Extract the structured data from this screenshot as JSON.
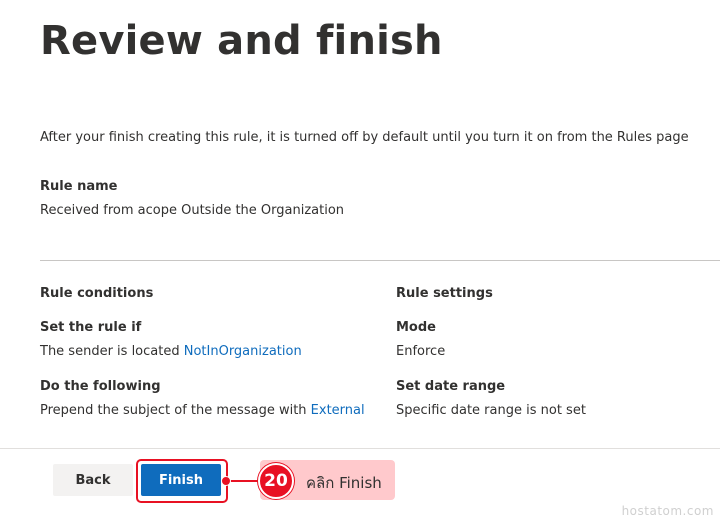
{
  "page": {
    "title": "Review and finish",
    "intro": "After your finish creating this rule, it is turned off by default until you turn it on from the Rules page"
  },
  "rule_name": {
    "label": "Rule name",
    "value": "Received from acope Outside the Organization"
  },
  "rule_conditions": {
    "heading": "Rule conditions",
    "set_rule_if": {
      "label": "Set the rule if",
      "text": "The sender is located ",
      "link": "NotInOrganization"
    },
    "do_following": {
      "label": "Do the following",
      "text": "Prepend the subject of the message with ",
      "link": "External"
    }
  },
  "rule_settings": {
    "heading": "Rule settings",
    "mode": {
      "label": "Mode",
      "value": "Enforce"
    },
    "date_range": {
      "label": "Set date range",
      "value": "Specific date range is not set"
    }
  },
  "footer": {
    "back_label": "Back",
    "finish_label": "Finish"
  },
  "annotation": {
    "step_number": "20",
    "text": "คลิก Finish"
  },
  "watermark": "hostatom.com",
  "colors": {
    "link": "#0f6cbd",
    "primary_button": "#0f6cbd",
    "annotation_red": "#e81123",
    "annotation_bg": "#ffc9cc"
  }
}
